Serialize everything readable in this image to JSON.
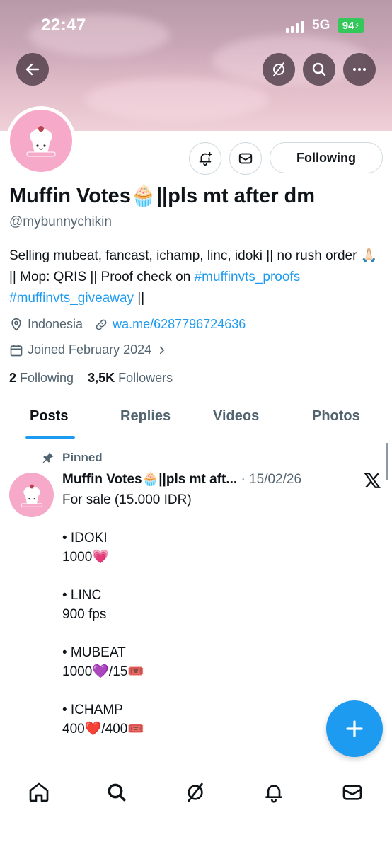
{
  "status_bar": {
    "time": "22:47",
    "network": "5G",
    "battery": "94"
  },
  "profile": {
    "display_name": "Muffin Votes🧁||pls mt after dm",
    "handle": "@mybunnychikin",
    "bio_text_1": "Selling mubeat, fancast, ichamp, linc, idoki || no rush order 🙏🏻 || Mop: QRIS || Proof check on ",
    "bio_hashtag_1": "#muffinvts_proofs",
    "bio_space": " ",
    "bio_hashtag_2": "#muffinvts_giveaway",
    "bio_text_2": " ||",
    "location": "Indonesia",
    "website": "wa.me/6287796724636",
    "joined": "Joined February 2024",
    "following_count": "2",
    "following_label": "Following",
    "followers_count": "3,5K",
    "followers_label": "Followers",
    "follow_button": "Following"
  },
  "tabs": [
    "Posts",
    "Replies",
    "Videos",
    "Photos"
  ],
  "pinned_post": {
    "pinned_label": "Pinned",
    "author": "Muffin Votes🧁||pls mt aft...",
    "date": " · 15/02/26",
    "lines": [
      "For sale (15.000 IDR)",
      "",
      "• IDOKI",
      "1000💗",
      "",
      "• LINC",
      "900 fps",
      "",
      "• MUBEAT",
      "1000💜/15🎟️",
      "",
      "• ICHAMP",
      "400❤️/400🎟️"
    ]
  },
  "colors": {
    "accent": "#1d9bf0",
    "muted": "#536471",
    "avatar_pink": "#f7a9c9"
  }
}
